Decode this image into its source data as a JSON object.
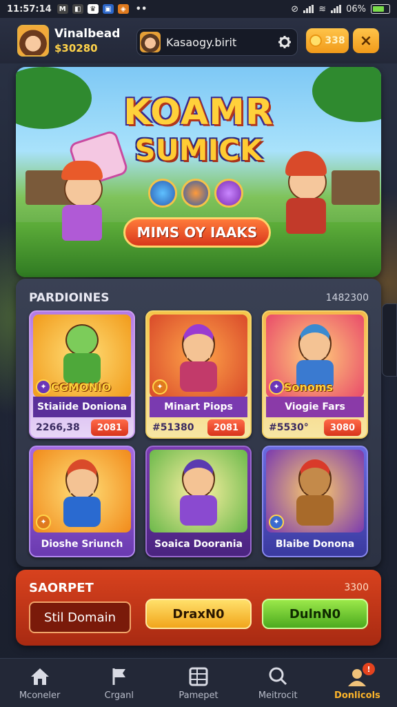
{
  "status_bar": {
    "time": "11:57:14",
    "battery": "06%"
  },
  "header": {
    "username": "Vinalbead",
    "coins": "$30280",
    "search_text": "Kasaogy.birit",
    "coin_button": "338",
    "close_icon": "×"
  },
  "banner": {
    "title_line1": "KOAMR",
    "title_line2": "SUMICK",
    "cta_label": "MIMS OY IAAKS"
  },
  "collection": {
    "title": "PARDIOINES",
    "value": "1482300",
    "cards": [
      {
        "badge_title": "CGMONIO",
        "name": "Stiaiide Doniona",
        "price": "2266,38",
        "buy": "2081"
      },
      {
        "badge_title": "",
        "name": "Minart Piops",
        "price": "#51380",
        "buy": "2081"
      },
      {
        "badge_title": "Sonoms",
        "name": "Viogie Fars",
        "price": "#5530°",
        "buy": "3080"
      },
      {
        "badge_title": "",
        "name": "Dioshe Sriunch",
        "price": "",
        "buy": ""
      },
      {
        "badge_title": "",
        "name": "Soaica Doorania",
        "price": "",
        "buy": ""
      },
      {
        "badge_title": "",
        "name": "Blaibe Donona",
        "price": "",
        "buy": ""
      }
    ]
  },
  "shop": {
    "title": "SAORPET",
    "value": "3300",
    "input_value": "Stil Domain",
    "yellow_button": "DraxN0",
    "green_button": "DulnN0"
  },
  "nav": {
    "items": [
      {
        "label": "Mconeler",
        "icon": "home-icon"
      },
      {
        "label": "Crganl",
        "icon": "flag-icon"
      },
      {
        "label": "Pamepet",
        "icon": "grid-icon"
      },
      {
        "label": "Meitrocit",
        "icon": "search-icon"
      },
      {
        "label": "Donlicols",
        "icon": "profile-icon"
      }
    ],
    "badge": "!"
  },
  "colors": {
    "accent": "#ffb62a",
    "panel": "#343a4c",
    "shop_panel": "#c43a1a",
    "card_name": "#5a2f9a"
  }
}
